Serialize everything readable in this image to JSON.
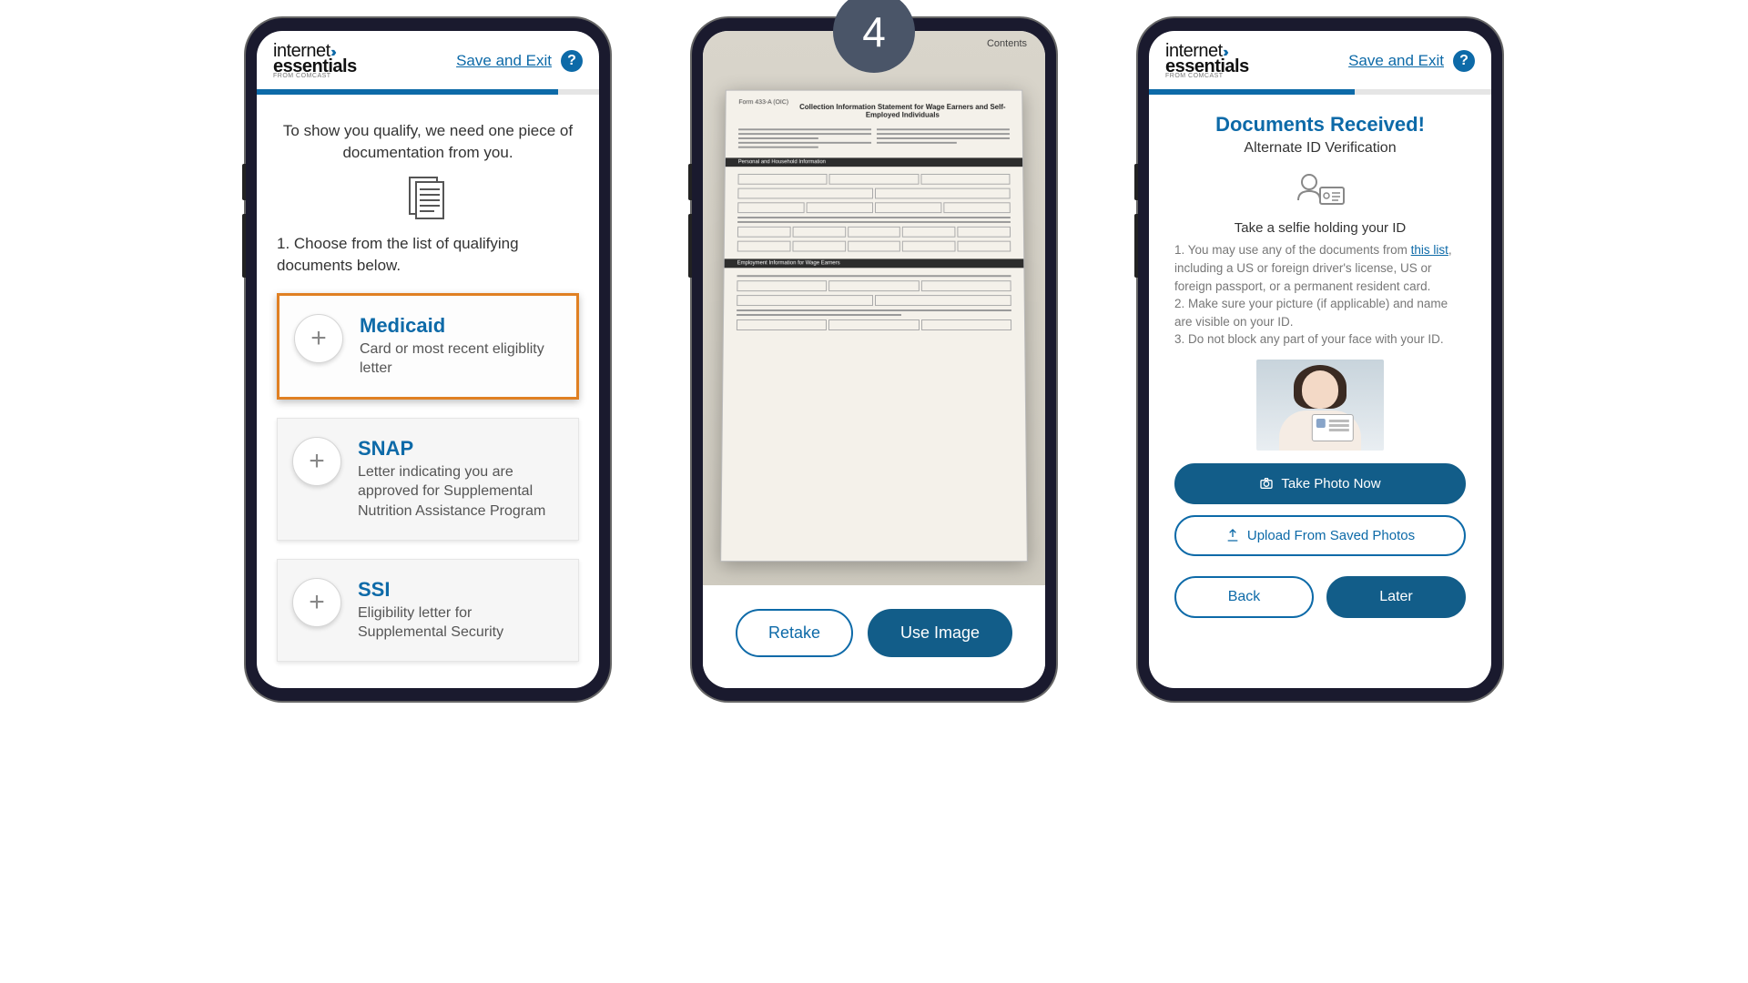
{
  "brand": {
    "line1": "internet",
    "line2": "essentials",
    "sub": "FROM COMCAST"
  },
  "common": {
    "save_exit": "Save and Exit",
    "help_char": "?"
  },
  "step_badge": "4",
  "phone1": {
    "progress_pct": 88,
    "intro": "To show you qualify, we need one piece of documentation from you.",
    "step": "1. Choose from the list of qualifying documents below.",
    "cards": [
      {
        "title": "Medicaid",
        "desc": "Card or most recent eligiblity letter"
      },
      {
        "title": "SNAP",
        "desc": "Letter indicating you are approved for Supplemental Nutrition Assistance Program"
      },
      {
        "title": "SSI",
        "desc": "Eligibility letter for Supplemental Security"
      }
    ]
  },
  "phone2": {
    "doc_code": "433-A (OIC)",
    "doc_title": "Collection Information Statement for Wage Earners and Self-Employed Individuals",
    "section1": "Personal and Household Information",
    "section2": "Employment Information for Wage Earners",
    "retake": "Retake",
    "use_image": "Use Image"
  },
  "phone3": {
    "progress_pct": 60,
    "title": "Documents Received!",
    "subtitle": "Alternate ID Verification",
    "lead": "Take a selfie holding your ID",
    "list_1a": "1. You may use any of the documents from ",
    "list_link": "this list",
    "list_1b": ", including a US or foreign driver's license, US or foreign passport, or a permanent resident card.",
    "list_2": "2. Make sure your picture (if applicable) and name are visible on your ID.",
    "list_3": "3. Do not block any part of your face with your ID.",
    "take_photo": "Take Photo Now",
    "upload": "Upload From Saved Photos",
    "back": "Back",
    "later": "Later"
  }
}
